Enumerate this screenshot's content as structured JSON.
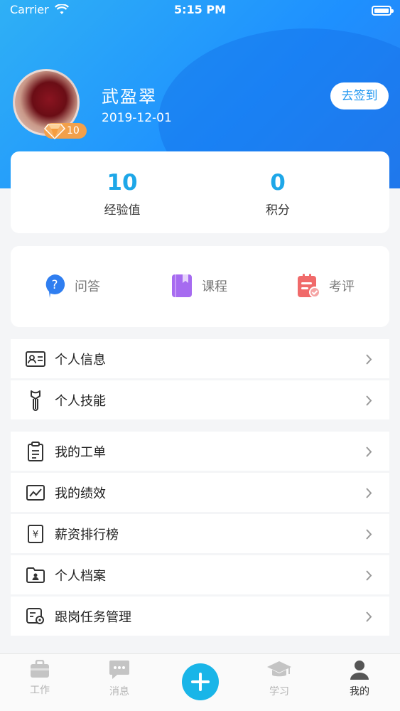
{
  "status": {
    "carrier": "Carrier",
    "time": "5:15 PM"
  },
  "profile": {
    "name": "武盈翠",
    "date": "2019-12-01",
    "level": "10",
    "checkin_label": "去签到"
  },
  "stats": [
    {
      "value": "10",
      "label": "经验值"
    },
    {
      "value": "0",
      "label": "积分"
    }
  ],
  "quick_actions": [
    {
      "label": "问答",
      "icon": "question-bubble-icon",
      "color": "#2f7ef0"
    },
    {
      "label": "课程",
      "icon": "book-icon",
      "color": "#a66bf0"
    },
    {
      "label": "考评",
      "icon": "clipboard-check-icon",
      "color": "#f06a6a"
    }
  ],
  "menu_group1": [
    {
      "label": "个人信息",
      "icon": "id-card-icon"
    },
    {
      "label": "个人技能",
      "icon": "wrench-icon"
    }
  ],
  "menu_group2": [
    {
      "label": "我的工单",
      "icon": "clipboard-icon"
    },
    {
      "label": "我的绩效",
      "icon": "chart-icon"
    },
    {
      "label": "薪资排行榜",
      "icon": "salary-icon"
    },
    {
      "label": "个人档案",
      "icon": "folder-user-icon"
    },
    {
      "label": "跟岗任务管理",
      "icon": "task-settings-icon"
    }
  ],
  "tabs": [
    {
      "label": "工作",
      "icon": "briefcase-icon"
    },
    {
      "label": "消息",
      "icon": "message-icon"
    },
    {
      "label": "学习",
      "icon": "graduation-cap-icon"
    },
    {
      "label": "我的",
      "icon": "person-icon"
    }
  ],
  "colors": {
    "accent": "#1ea7e8",
    "header": "#1e90ff",
    "badge": "#f2a04b"
  }
}
